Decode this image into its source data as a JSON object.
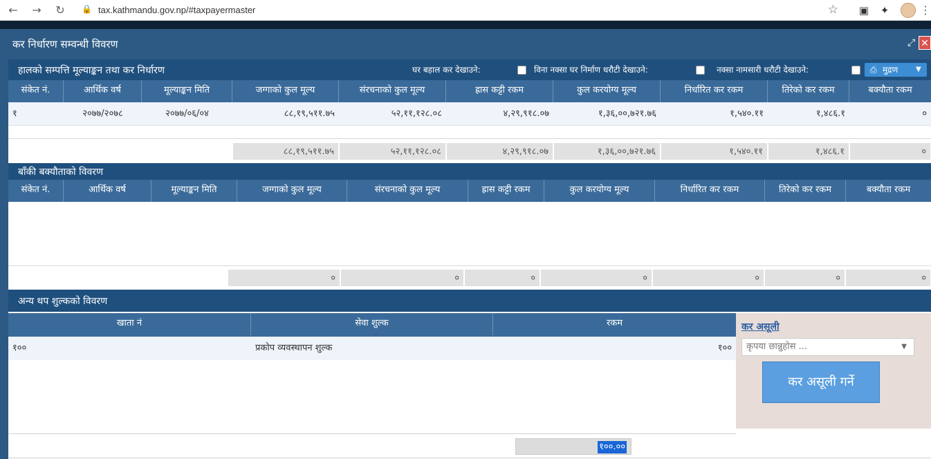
{
  "browser": {
    "url": "tax.kathmandu.gov.np/#taxpayermaster"
  },
  "modal": {
    "title": "कर निर्धारण सम्वन्धी विवरण"
  },
  "section1": {
    "title": "हालको सम्पत्ति मूल्याङ्कन तथा कर निर्धारण",
    "opt_rent": "घर बहाल कर देखाउने:",
    "opt_no_map": "विना नक्सा घर निर्माण धरौटी देखाउने:",
    "opt_map_transfer": "नक्सा नामसारी धरौटी देखाउने:",
    "print_label": "मुद्रण",
    "columns": [
      "संकेत नं.",
      "आर्थिक वर्ष",
      "मूल्याङ्कन मिति",
      "जग्गाको कुल मूल्य",
      "संरचनाको कुल मूल्य",
      "ह्रास कट्टी रकम",
      "कुल करयोग्य मूल्य",
      "निर्धारित कर रकम",
      "तिरेको कर रकम",
      "बक्यौता रकम"
    ],
    "row": [
      "१",
      "२०७७/२०७८",
      "२०७७/०६/०४",
      "८८,१९,५११.७५",
      "५२,११,१२८.०८",
      "४,२९,९१८.०७",
      "१,३६,००,७२१.७६",
      "१,५४०.११",
      "१,४८६.१",
      "०"
    ],
    "totals": [
      "८८,१९,५११.७५",
      "५२,११,१२८.०८",
      "४,२९,९१८.०७",
      "१,३६,००,७२१.७६",
      "१,५४०.११",
      "१,४८६.१",
      "०"
    ]
  },
  "section2": {
    "title": "बाँकी बक्यौताको विवरण",
    "columns": [
      "संकेत नं.",
      "आर्थिक वर्ष",
      "मूल्याङ्कन मिति",
      "जग्गाको कुल मूल्य",
      "संरचनाको कुल मूल्य",
      "ह्रास कट्टी रकम",
      "कुल करयोग्य मूल्य",
      "निर्धारित कर रकम",
      "तिरेको कर रकम",
      "बक्यौता रकम"
    ],
    "totals": [
      "०",
      "०",
      "०",
      "०",
      "०",
      "०",
      "०"
    ]
  },
  "section3": {
    "title": "अन्य थप शुल्कको विवरण",
    "columns": [
      "खाता नं",
      "सेवा शुल्क",
      "रकम"
    ],
    "row": [
      "१००",
      "प्रकोप व्यवस्थापन शुल्क",
      "१००"
    ],
    "total": "१००.००"
  },
  "side": {
    "link": "कर असूली",
    "select_placeholder": "कृपया छान्नुहोस ...",
    "button": "कर असूली गर्ने"
  }
}
